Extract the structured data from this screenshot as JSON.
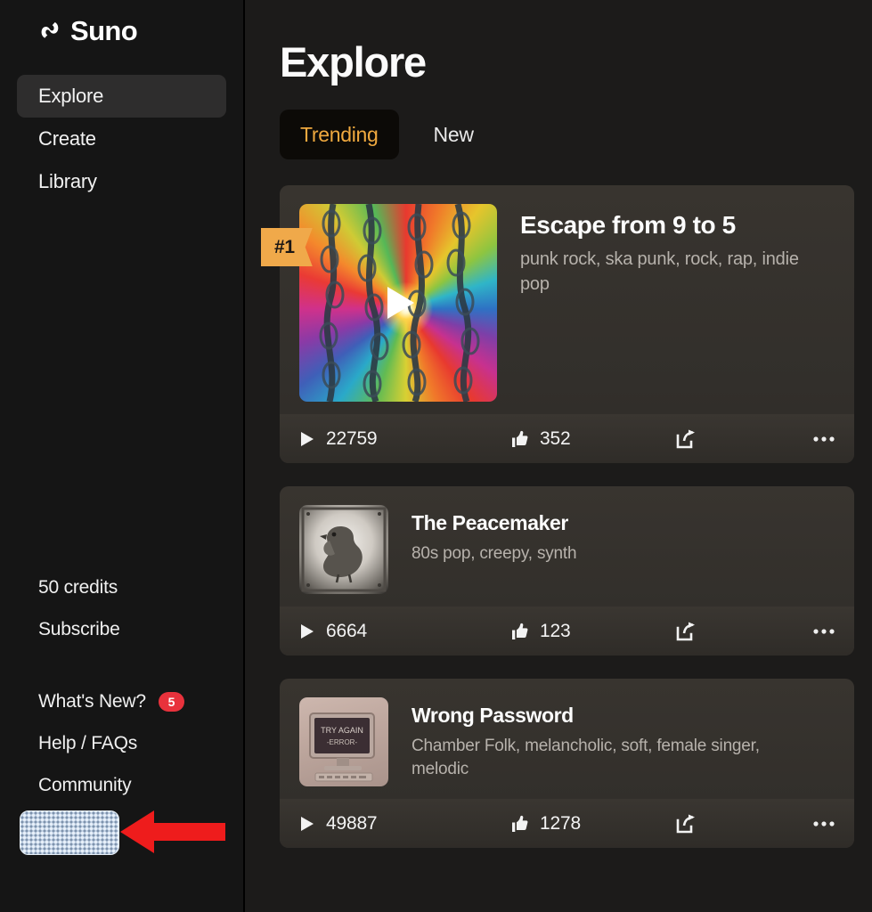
{
  "brand": {
    "name": "Suno",
    "logo_icon": "suno-wave-logo-icon"
  },
  "sidebar": {
    "nav_items": [
      {
        "label": "Explore",
        "active": true
      },
      {
        "label": "Create",
        "active": false
      },
      {
        "label": "Library",
        "active": false
      }
    ],
    "credits_label": "50 credits",
    "subscribe_label": "Subscribe",
    "secondary_items": [
      {
        "label": "What's New?",
        "badge": "5"
      },
      {
        "label": "Help / FAQs",
        "badge": ""
      },
      {
        "label": "Community",
        "badge": ""
      }
    ],
    "account_chip": {
      "redacted": true,
      "label": ""
    }
  },
  "annotation": {
    "arrow_icon": "left-pointing-arrow-icon",
    "arrow_color": "#ee1c1c",
    "points_at": "account-chip-redacted"
  },
  "main": {
    "title": "Explore",
    "tabs": [
      {
        "label": "Trending",
        "active": true
      },
      {
        "label": "New",
        "active": false
      }
    ],
    "accent_color": "#f0a93f",
    "cards": [
      {
        "rank_badge": "#1",
        "title": "Escape from 9 to 5",
        "tags": "punk rock, ska punk, rock, rap, indie pop",
        "plays": "22759",
        "likes": "352",
        "art": "rainbow-chains-burst",
        "play_icon": "play-icon",
        "like_icon": "thumbs-up-icon",
        "share_icon": "share-icon",
        "more_icon": "more-options-icon"
      },
      {
        "rank_badge": "",
        "title": "The Peacemaker",
        "tags": "80s pop, creepy, synth",
        "plays": "6664",
        "likes": "123",
        "art": "engraved-dove",
        "play_icon": "play-icon",
        "like_icon": "thumbs-up-icon",
        "share_icon": "share-icon",
        "more_icon": "more-options-icon"
      },
      {
        "rank_badge": "",
        "title": "Wrong Password",
        "tags": "Chamber Folk, melancholic, soft, female singer, melodic",
        "plays": "49887",
        "likes": "1278",
        "art": "retro-computer-monitor",
        "play_icon": "play-icon",
        "like_icon": "thumbs-up-icon",
        "share_icon": "share-icon",
        "more_icon": "more-options-icon"
      }
    ]
  }
}
